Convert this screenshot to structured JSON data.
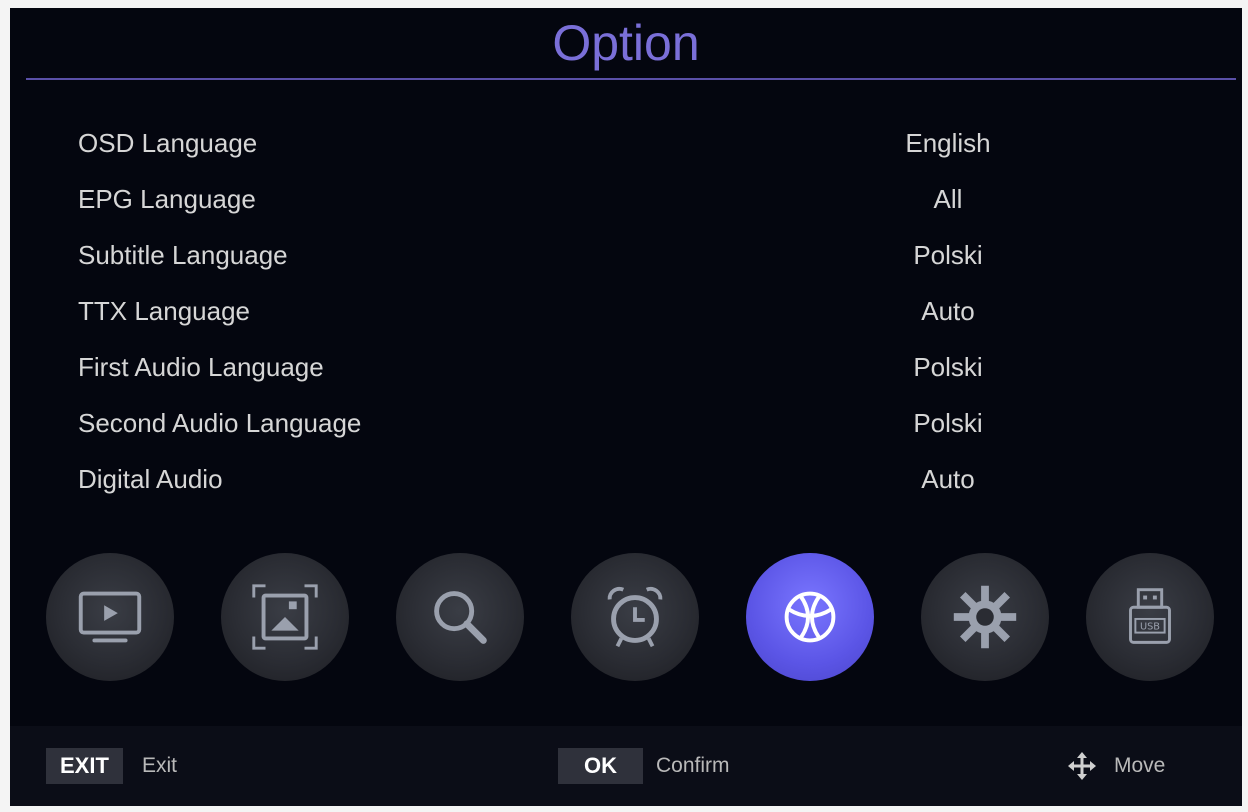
{
  "menu": {
    "title": "Option",
    "rows": [
      {
        "label": "OSD Language",
        "value": "English"
      },
      {
        "label": "EPG Language",
        "value": "All"
      },
      {
        "label": "Subtitle Language",
        "value": "Polski"
      },
      {
        "label": "TTX Language",
        "value": "Auto"
      },
      {
        "label": "First Audio Language",
        "value": "Polski"
      },
      {
        "label": "Second Audio Language",
        "value": "Polski"
      },
      {
        "label": "Digital Audio",
        "value": "Auto"
      }
    ]
  },
  "categories": [
    {
      "icon": "tv-play-icon",
      "active": false
    },
    {
      "icon": "picture-icon",
      "active": false
    },
    {
      "icon": "search-icon",
      "active": false
    },
    {
      "icon": "alarm-clock-icon",
      "active": false
    },
    {
      "icon": "globe-ball-icon",
      "active": true
    },
    {
      "icon": "gear-icon",
      "active": false
    },
    {
      "icon": "usb-icon",
      "active": false
    }
  ],
  "footer": {
    "exit_key": "EXIT",
    "exit_label": "Exit",
    "ok_key": "OK",
    "ok_label": "Confirm",
    "move_icon": "move-arrows-icon",
    "move_label": "Move"
  },
  "colors": {
    "accent": "#5b55e6",
    "title": "#7a6fd8",
    "background": "#04060f"
  }
}
